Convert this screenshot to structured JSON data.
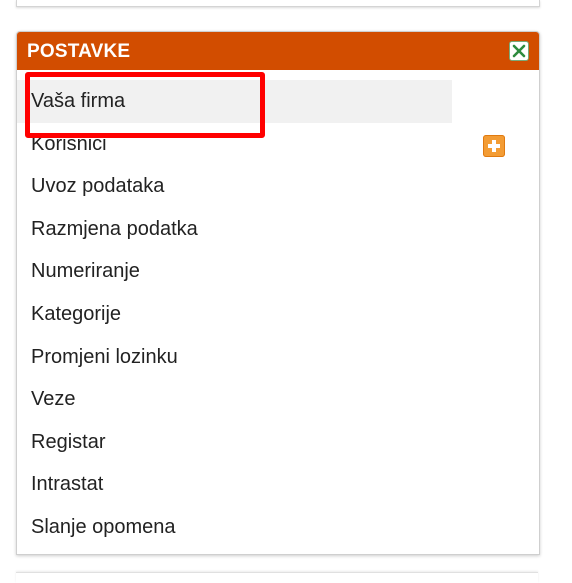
{
  "panel": {
    "title": "POSTAVKE",
    "header_color": "#d24d00",
    "items": [
      {
        "label": "Vaša firma"
      },
      {
        "label": "Korisnici"
      },
      {
        "label": "Uvoz podataka"
      },
      {
        "label": "Razmjena podatka"
      },
      {
        "label": "Numeriranje"
      },
      {
        "label": "Kategorije"
      },
      {
        "label": "Promjeni lozinku"
      },
      {
        "label": "Veze"
      },
      {
        "label": "Registar"
      },
      {
        "label": "Intrastat"
      },
      {
        "label": "Slanje opomena"
      }
    ]
  },
  "icons": {
    "close": "close-icon",
    "add": "plus-icon"
  },
  "colors": {
    "highlight": "#ff0000",
    "add_button": "#f39c34"
  }
}
